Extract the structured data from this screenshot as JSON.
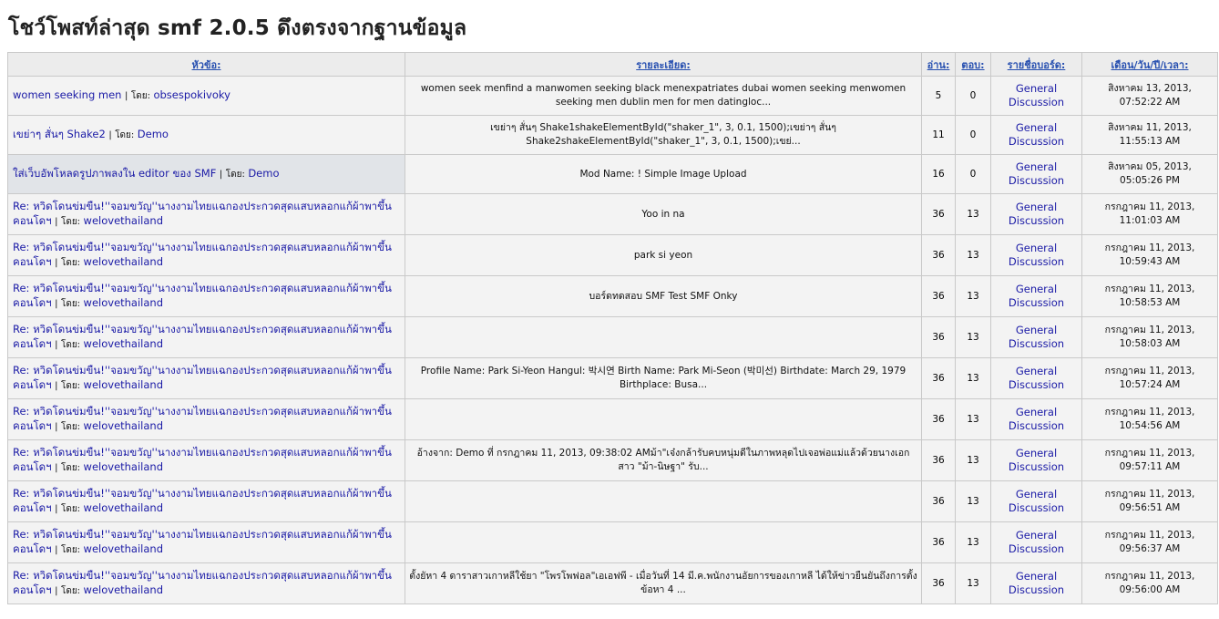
{
  "page": {
    "title": "โชว์โพสท์ล่าสุด smf 2.0.5 ดึงตรงจากฐานข้อมูล"
  },
  "table": {
    "headers": {
      "topic": "หัวข้อ:",
      "detail": "รายละเอียด:",
      "reads": "อ่าน:",
      "replies": "ตอบ:",
      "board": "รายชื่อบอร์ด:",
      "date": "เดือน/วัน/ปี/เวลา:"
    },
    "separator": "|",
    "by_label": "โดย:",
    "rows": [
      {
        "topic": "women seeking men",
        "author": "obsespokivoky",
        "detail": "women seek menfind a manwomen seeking black menexpatriates dubai women seeking menwomen seeking men dublin men for men datingloc...",
        "reads": "5",
        "replies": "0",
        "board": "General Discussion",
        "date": "สิงหาคม 13, 2013, 07:52:22 AM"
      },
      {
        "topic": "เขย่าๆ สั่นๆ Shake2",
        "author": "Demo",
        "detail": "เขย่าๆ สั่นๆ Shake1shakeElementById(\"shaker_1\", 3, 0.1, 1500);เขย่าๆ สั่นๆ Shake2shakeElementById(\"shaker_1\", 3, 0.1, 1500);เขย่...",
        "reads": "11",
        "replies": "0",
        "board": "General Discussion",
        "date": "สิงหาคม 11, 2013, 11:55:13 AM"
      },
      {
        "topic": "ใส่เว็บอัพโหลดรูปภาพลงใน editor ของ SMF",
        "author": "Demo",
        "detail": "Mod Name: ! Simple Image Upload",
        "reads": "16",
        "replies": "0",
        "board": "General Discussion",
        "date": "สิงหาคม 05, 2013, 05:05:26 PM"
      },
      {
        "topic": "Re: หวิดโดนข่มขืน!''จอมขวัญ''นางงามไทยแฉกองประกวดสุดแสบหลอกแก้ผ้าพาขึ้นคอนโดฯ",
        "author": "welovethailand",
        "detail": "Yoo in na",
        "reads": "36",
        "replies": "13",
        "board": "General Discussion",
        "date": "กรกฎาคม 11, 2013, 11:01:03 AM"
      },
      {
        "topic": "Re: หวิดโดนข่มขืน!''จอมขวัญ''นางงามไทยแฉกองประกวดสุดแสบหลอกแก้ผ้าพาขึ้นคอนโดฯ",
        "author": "welovethailand",
        "detail": "park si yeon",
        "reads": "36",
        "replies": "13",
        "board": "General Discussion",
        "date": "กรกฎาคม 11, 2013, 10:59:43 AM"
      },
      {
        "topic": "Re: หวิดโดนข่มขืน!''จอมขวัญ''นางงามไทยแฉกองประกวดสุดแสบหลอกแก้ผ้าพาขึ้นคอนโดฯ",
        "author": "welovethailand",
        "detail": "บอร์ดทดสอบ SMF Test SMF Onky",
        "reads": "36",
        "replies": "13",
        "board": "General Discussion",
        "date": "กรกฎาคม 11, 2013, 10:58:53 AM"
      },
      {
        "topic": "Re: หวิดโดนข่มขืน!''จอมขวัญ''นางงามไทยแฉกองประกวดสุดแสบหลอกแก้ผ้าพาขึ้นคอนโดฯ",
        "author": "welovethailand",
        "detail": "",
        "reads": "36",
        "replies": "13",
        "board": "General Discussion",
        "date": "กรกฎาคม 11, 2013, 10:58:03 AM"
      },
      {
        "topic": "Re: หวิดโดนข่มขืน!''จอมขวัญ''นางงามไทยแฉกองประกวดสุดแสบหลอกแก้ผ้าพาขึ้นคอนโดฯ",
        "author": "welovethailand",
        "detail": "Profile    Name: Park Si-Yeon    Hangul: 박시연    Birth Name: Park Mi-Seon (박미선)    Birthdate: March 29, 1979    Birthplace: Busa...",
        "reads": "36",
        "replies": "13",
        "board": "General Discussion",
        "date": "กรกฎาคม 11, 2013, 10:57:24 AM"
      },
      {
        "topic": "Re: หวิดโดนข่มขืน!''จอมขวัญ''นางงามไทยแฉกองประกวดสุดแสบหลอกแก้ผ้าพาขึ้นคอนโดฯ",
        "author": "welovethailand",
        "detail": "",
        "reads": "36",
        "replies": "13",
        "board": "General Discussion",
        "date": "กรกฎาคม 11, 2013, 10:54:56 AM"
      },
      {
        "topic": "Re: หวิดโดนข่มขืน!''จอมขวัญ''นางงามไทยแฉกองประกวดสุดแสบหลอกแก้ผ้าพาขึ้นคอนโดฯ",
        "author": "welovethailand",
        "detail": "อ้างจาก: Demo ที่ กรกฎาคม 11, 2013, 09:38:02 AMม้า\"เจ๋งกล้ารับคบหนุ่มดีในภาพหลุดไปเจอพ่อแม่แล้วด้วยนางเอกสาว \"ม้า-นิษฐา\" รับ...",
        "reads": "36",
        "replies": "13",
        "board": "General Discussion",
        "date": "กรกฎาคม 11, 2013, 09:57:11 AM"
      },
      {
        "topic": "Re: หวิดโดนข่มขืน!''จอมขวัญ''นางงามไทยแฉกองประกวดสุดแสบหลอกแก้ผ้าพาขึ้นคอนโดฯ",
        "author": "welovethailand",
        "detail": "",
        "reads": "36",
        "replies": "13",
        "board": "General Discussion",
        "date": "กรกฎาคม 11, 2013, 09:56:51 AM"
      },
      {
        "topic": "Re: หวิดโดนข่มขืน!''จอมขวัญ''นางงามไทยแฉกองประกวดสุดแสบหลอกแก้ผ้าพาขึ้นคอนโดฯ",
        "author": "welovethailand",
        "detail": "",
        "reads": "36",
        "replies": "13",
        "board": "General Discussion",
        "date": "กรกฎาคม 11, 2013, 09:56:37 AM"
      },
      {
        "topic": "Re: หวิดโดนข่มขืน!''จอมขวัญ''นางงามไทยแฉกองประกวดสุดแสบหลอกแก้ผ้าพาขึ้นคอนโดฯ",
        "author": "welovethailand",
        "detail": "ตั้งยัหา 4 ดาราสาวเกาหลีใช้ยา \"โพรโพฟอล\"เอเอฟพี - เมื่อวันที่ 14 มี.ค.พนักงานอัยการของเกาหลี ได้ให้ข่าวยืนยันถึงการตั้งข้อหา 4 ...",
        "reads": "36",
        "replies": "13",
        "board": "General Discussion",
        "date": "กรกฎาคม 11, 2013, 09:56:00 AM"
      }
    ]
  }
}
